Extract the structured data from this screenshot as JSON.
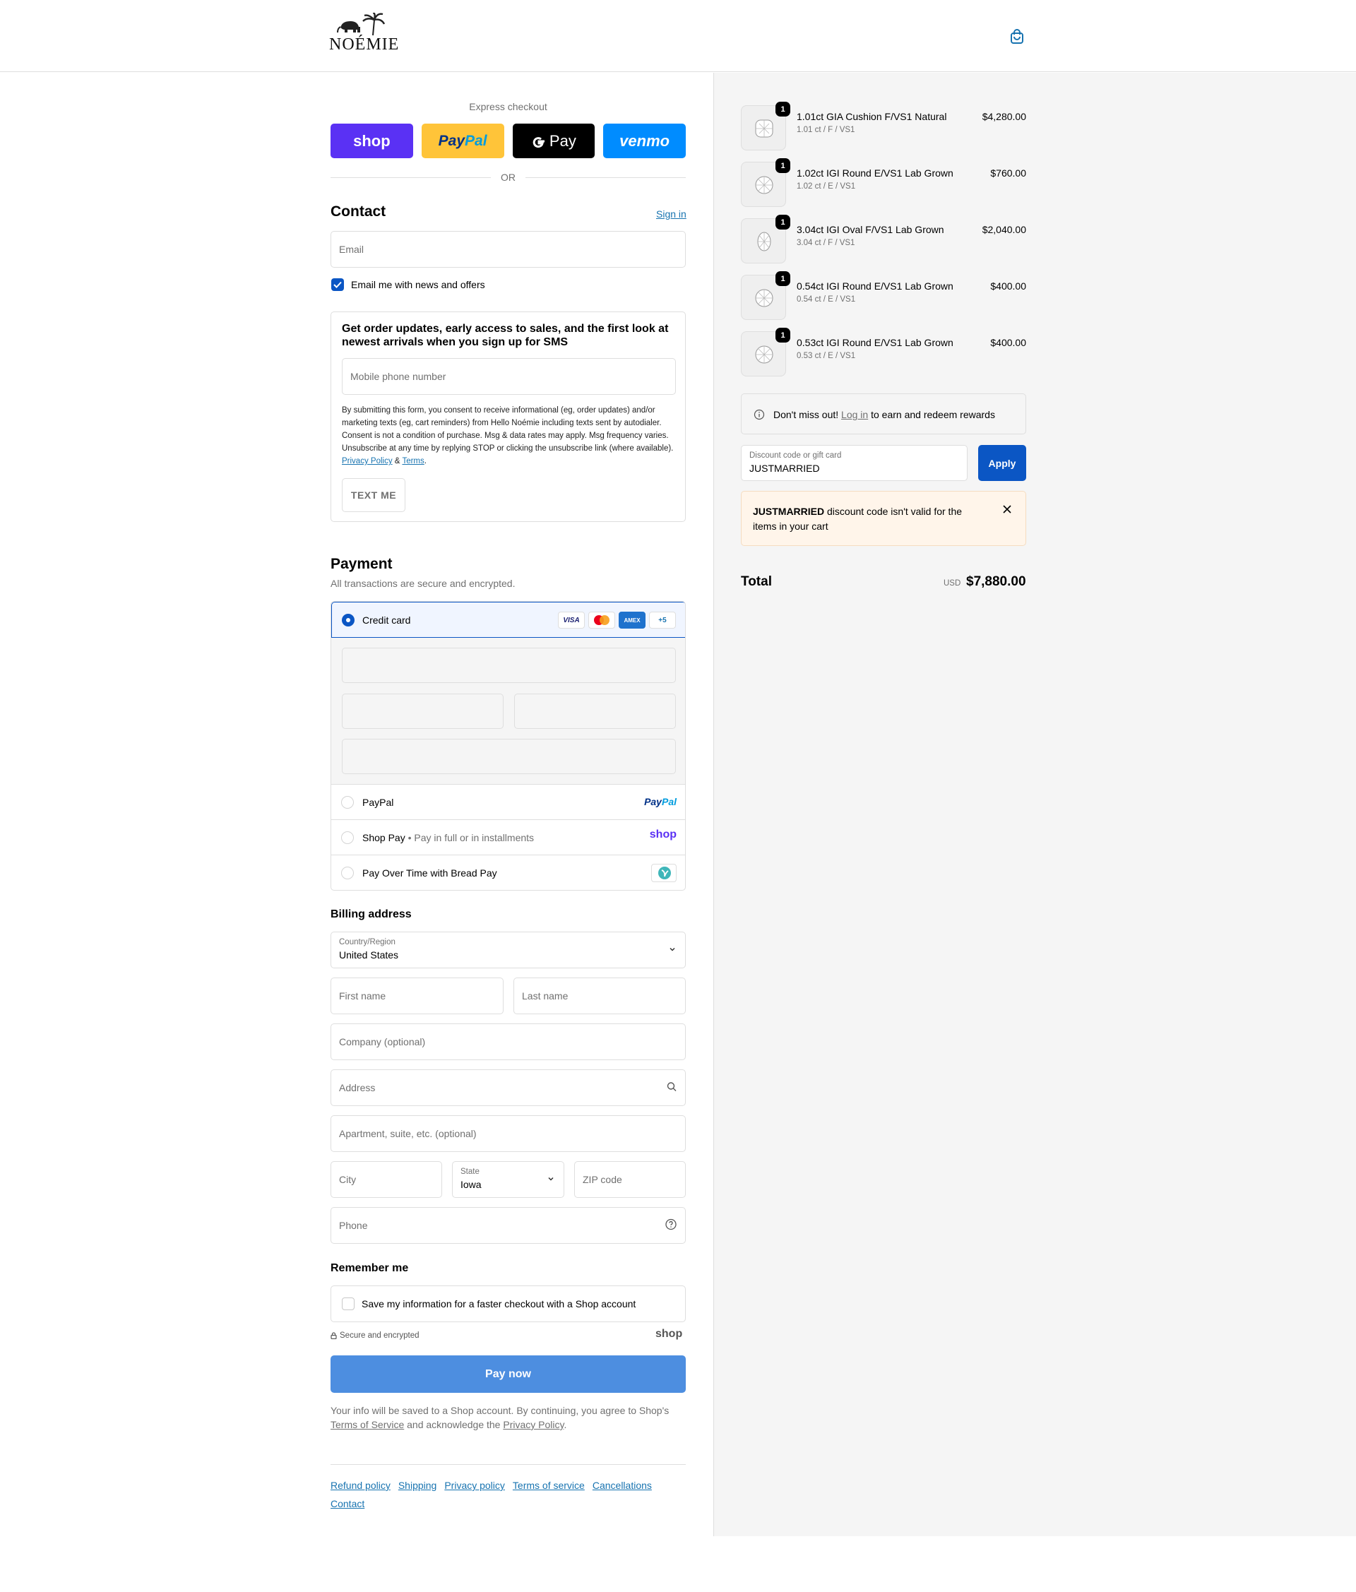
{
  "header": {
    "brand": "NOÉMIE"
  },
  "express": {
    "title": "Express checkout",
    "shop": "shop",
    "paypal_a": "Pay",
    "paypal_b": "Pal",
    "gpay": "Pay",
    "venmo": "venmo",
    "or": "OR"
  },
  "contact": {
    "title": "Contact",
    "sign_in": "Sign in",
    "email_placeholder": "Email",
    "news_label": "Email me with news and offers"
  },
  "sms": {
    "title": "Get order updates, early access to sales, and the first look at newest arrivals when you sign up for SMS",
    "phone_placeholder": "Mobile phone number",
    "legal": "By submitting this form, you consent to receive informational (eg, order updates) and/or marketing texts (eg, cart reminders) from Hello Noémie including texts sent by autodialer. Consent is not a condition of purchase. Msg & data rates may apply. Msg frequency varies. Unsubscribe at any time by replying STOP or clicking the unsubscribe link (where available).",
    "privacy": "Privacy Policy",
    "amp": "&",
    "terms": "Terms",
    "dot": ".",
    "button": "TEXT ME"
  },
  "payment": {
    "title": "Payment",
    "subtitle": "All transactions are secure and encrypted.",
    "credit_card": "Credit card",
    "visa": "VISA",
    "amex": "AMEX",
    "more_cards": "+5",
    "paypal": "PayPal",
    "paypal_logo_a": "Pay",
    "paypal_logo_b": "Pal",
    "shop_pay": "Shop Pay",
    "shop_pay_dot": "•",
    "shop_pay_sub": "Pay in full or in installments",
    "shop_logo": "shop",
    "bread_pay": "Pay Over Time with Bread Pay"
  },
  "billing": {
    "title": "Billing address",
    "country_label": "Country/Region",
    "country_value": "United States",
    "first_name": "First name",
    "last_name": "Last name",
    "company": "Company (optional)",
    "address": "Address",
    "apartment": "Apartment, suite, etc. (optional)",
    "city": "City",
    "state_label": "State",
    "state_value": "Iowa",
    "zip": "ZIP code",
    "phone": "Phone"
  },
  "remember": {
    "title": "Remember me",
    "save_label": "Save my information for a faster checkout with a Shop account",
    "secure": "Secure and encrypted",
    "shop_logo": "shop"
  },
  "pay_now": "Pay now",
  "consent": {
    "text1": "Your info will be saved to a Shop account. By continuing, you agree to Shop's",
    "tos": "Terms of Service",
    "text2": "and acknowledge the",
    "privacy": "Privacy Policy",
    "end": "."
  },
  "footer": {
    "links": [
      "Refund policy",
      "Shipping",
      "Privacy policy",
      "Terms of service",
      "Cancellations",
      "Contact"
    ]
  },
  "cart": {
    "items": [
      {
        "qty": "1",
        "name": "1.01ct GIA Cushion F/VS1 Natural",
        "variant": "1.01 ct / F / VS1",
        "price": "$4,280.00"
      },
      {
        "qty": "1",
        "name": "1.02ct IGI Round E/VS1 Lab Grown",
        "variant": "1.02 ct / E / VS1",
        "price": "$760.00"
      },
      {
        "qty": "1",
        "name": "3.04ct IGI Oval F/VS1 Lab Grown",
        "variant": "3.04 ct / F / VS1",
        "price": "$2,040.00"
      },
      {
        "qty": "1",
        "name": "0.54ct IGI Round E/VS1 Lab Grown",
        "variant": "0.54 ct / E / VS1",
        "price": "$400.00"
      },
      {
        "qty": "1",
        "name": "0.53ct IGI Round E/VS1 Lab Grown",
        "variant": "0.53 ct / E / VS1",
        "price": "$400.00"
      }
    ],
    "rewards_a": "Don't miss out!",
    "rewards_link": "Log in",
    "rewards_b": "to earn and redeem rewards",
    "discount_label": "Discount code or gift card",
    "discount_value": "JUSTMARRIED",
    "apply": "Apply",
    "error_code": "JUSTMARRIED",
    "error_msg": "discount code isn't valid for the items in your cart",
    "total_label": "Total",
    "currency": "USD",
    "total": "$7,880.00"
  },
  "colors": {
    "accent": "#0b56c4",
    "link": "#1773b0",
    "pay_now": "#4d8ee0",
    "shop": "#5a31f4",
    "paypal": "#ffc439",
    "venmo": "#008cff"
  }
}
